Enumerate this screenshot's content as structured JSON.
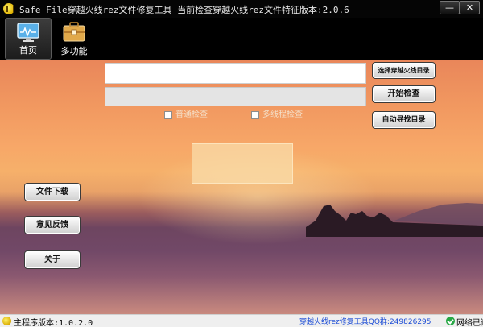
{
  "titlebar": {
    "title": "Safe  File穿越火线rez文件修复工具     当前检查穿越火线rez文件特征版本:2.0.6",
    "minimize_label": "—",
    "close_label": "✕"
  },
  "toolbar": {
    "items": [
      {
        "label": "首页",
        "icon": "monitor-icon",
        "active": true
      },
      {
        "label": "多功能",
        "icon": "toolbox-icon",
        "active": false
      }
    ]
  },
  "main": {
    "path_input_value": "",
    "path_display_value": "",
    "buttons": {
      "select_dir": "选择穿越火线目录",
      "start_check": "开始检查",
      "auto_find": "自动寻找目录",
      "download": "文件下载",
      "feedback": "意见反馈",
      "about": "关于"
    },
    "checks": {
      "normal": "普通检查",
      "multi_thread": "多线程检查"
    }
  },
  "statusbar": {
    "version": "主程序版本:1.0.2.0",
    "qq_link": "穿越火线rez修复工具QQ群:249826295",
    "network": "网络已连接"
  },
  "colors": {
    "sky_top": "#e9865a",
    "sky_mid": "#f7a768",
    "sea": "#714867",
    "link": "#1a4bd6",
    "network_ok": "#27a845"
  }
}
